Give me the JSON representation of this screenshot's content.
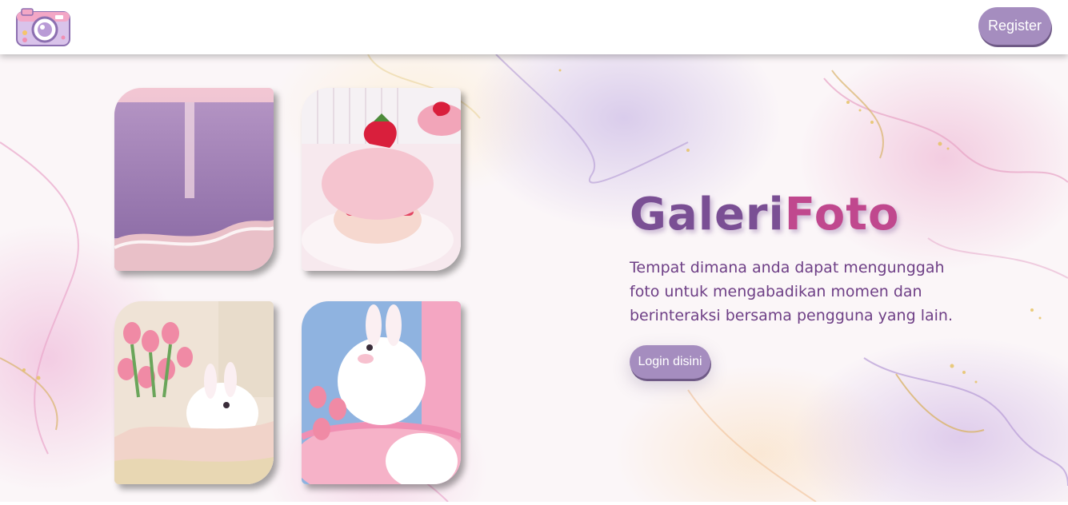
{
  "navbar": {
    "logo_icon": "camera-icon",
    "register_label": "Register"
  },
  "hero": {
    "title_part1": "Galeri",
    "title_part2": "Foto",
    "description": "Tempat dimana anda dapat mengunggah foto untuk mengabadikan momen dan berinteraksi bersama pengguna yang lain.",
    "login_label": "Login disini"
  },
  "gallery": [
    {
      "subject": "sunset-beach-photo"
    },
    {
      "subject": "strawberry-cake-photo"
    },
    {
      "subject": "bunny-with-tulips-photo"
    },
    {
      "subject": "bunny-in-pink-basket-photo"
    }
  ],
  "colors": {
    "accent": "#a58dbf",
    "title_purple": "#7a4f94",
    "title_pink": "#c0488e",
    "text": "#6e3f86"
  }
}
